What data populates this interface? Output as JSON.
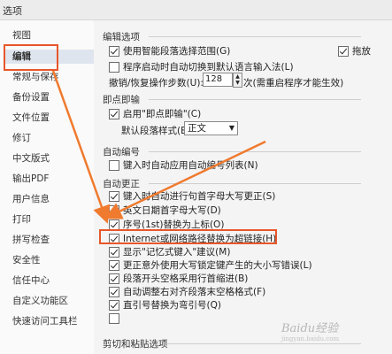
{
  "window": {
    "title": "选项"
  },
  "sidebar": {
    "items": [
      {
        "label": "视图"
      },
      {
        "label": "编辑"
      },
      {
        "label": "常规与保存"
      },
      {
        "label": "备份设置"
      },
      {
        "label": "文件位置"
      },
      {
        "label": "修订"
      },
      {
        "label": "中文版式"
      },
      {
        "label": "输出PDF"
      },
      {
        "label": "用户信息"
      },
      {
        "label": "打印"
      },
      {
        "label": "拼写检查"
      },
      {
        "label": "安全性"
      },
      {
        "label": "信任中心"
      },
      {
        "label": "自定义功能区"
      },
      {
        "label": "快速访问工具栏"
      }
    ],
    "active_index": 1
  },
  "main": {
    "edit_options_title": "编辑选项",
    "smart_paragraph": "使用智能段落选择范围(G)",
    "drag_label": "拖放",
    "auto_input_method": "程序启动时自动切换到默认语言输入法(L)",
    "undo_steps_label": "撤销/恢复操作步数(U):",
    "undo_steps_value": "128",
    "undo_steps_suffix": "次(需重启程序才能生效)",
    "instant_typing_title": "即点即输",
    "instant_typing_enable": "启用\"即点即输\"(C)",
    "default_paragraph_style_label": "默认段落样式(E):",
    "default_paragraph_style_value": "正文",
    "auto_numbering_title": "自动编号",
    "auto_numbering_option": "键入时自动应用自动编号列表(N)",
    "autocorrect_title": "自动更正",
    "autocorrect_items": [
      {
        "label": "键入时自动进行句首字母大写更正(S)",
        "checked": true
      },
      {
        "label": "英文日期首字母大写(D)",
        "checked": true
      },
      {
        "label": "序号(1st)替换为上标(O)",
        "checked": true
      },
      {
        "label": "Internet或网络路径替换为超链接(H)",
        "checked": true
      },
      {
        "label": "显示\"记忆式键入\"建议(M)",
        "checked": true
      },
      {
        "label": "更正意外使用大写锁定键产生的大小写错误(L)",
        "checked": true
      },
      {
        "label": "段落开头空格采用行首缩进(B)",
        "checked": true
      },
      {
        "label": "自动调整右对齐段落末空格格式(F)",
        "checked": true
      },
      {
        "label": "直引号替换为弯引号(Q)",
        "checked": true
      },
      {
        "label": "",
        "checked": false
      }
    ],
    "cut_paste_title": "剪切和粘贴选项"
  },
  "watermark": "Baidu经验",
  "watermark_sub": "jingyan.baidu.com",
  "colors": {
    "highlight": "#e8562a",
    "arrow": "#f07a2e"
  }
}
